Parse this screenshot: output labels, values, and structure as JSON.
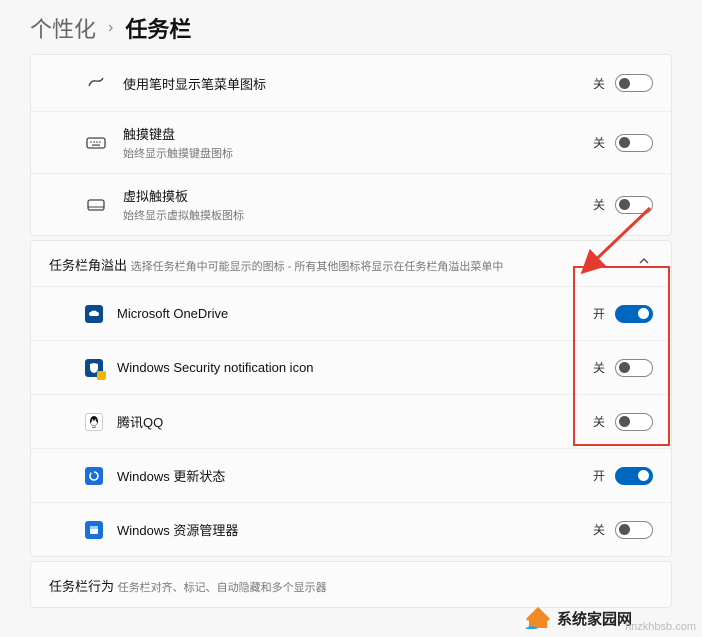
{
  "breadcrumb": {
    "parent": "个性化",
    "current": "任务栏"
  },
  "cornerIcons": {
    "pen": {
      "title": "使用笔时显示笔菜单图标",
      "subtitle": "",
      "state": "关",
      "on": false
    },
    "touchKeyboard": {
      "title": "触摸键盘",
      "subtitle": "始终显示触摸键盘图标",
      "state": "关",
      "on": false
    },
    "touchpad": {
      "title": "虚拟触摸板",
      "subtitle": "始终显示虚拟触摸板图标",
      "state": "关",
      "on": false
    }
  },
  "overflow": {
    "header": {
      "title": "任务栏角溢出",
      "subtitle": "选择任务栏角中可能显示的图标 - 所有其他图标将显示在任务栏角溢出菜单中"
    },
    "items": [
      {
        "label": "Microsoft OneDrive",
        "state": "开",
        "on": true
      },
      {
        "label": "Windows Security notification icon",
        "state": "关",
        "on": false
      },
      {
        "label": "腾讯QQ",
        "state": "关",
        "on": false
      },
      {
        "label": "Windows 更新状态",
        "state": "开",
        "on": true
      },
      {
        "label": "Windows 资源管理器",
        "state": "关",
        "on": false
      }
    ]
  },
  "behavior": {
    "title": "任务栏行为",
    "subtitle": "任务栏对齐、标记、自动隐藏和多个显示器"
  },
  "branding": {
    "text": "系统家园网",
    "watermark": "hnzkhbsb.com"
  }
}
